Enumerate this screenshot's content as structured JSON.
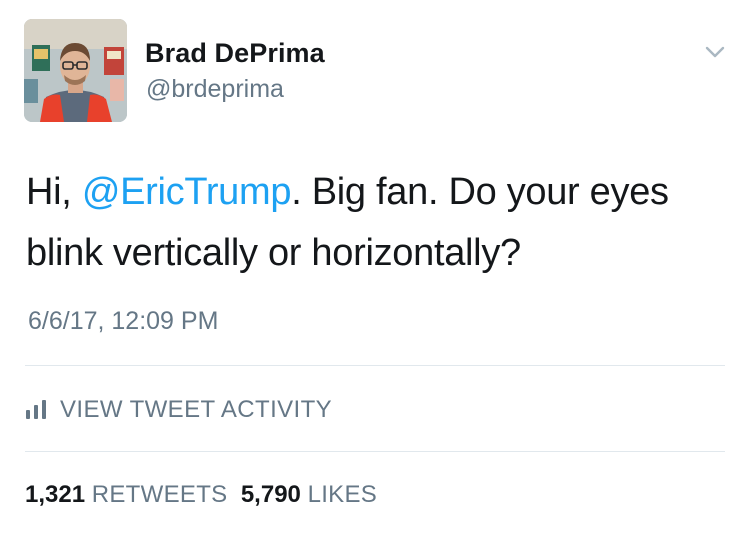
{
  "author": {
    "display_name": "Brad DePrima",
    "handle": "@brdeprima"
  },
  "tweet": {
    "text_before": "Hi, ",
    "mention": "@EricTrump",
    "text_after": ". Big fan. Do your eyes blink vertically or horizontally?",
    "timestamp": "6/6/17, 12:09 PM"
  },
  "activity": {
    "label": "VIEW TWEET ACTIVITY",
    "icon": "bar-chart-icon"
  },
  "stats": {
    "retweets_count": "1,321",
    "retweets_label": "RETWEETS",
    "likes_count": "5,790",
    "likes_label": "LIKES"
  },
  "icons": {
    "menu": "chevron-down-icon",
    "avatar": "avatar"
  },
  "colors": {
    "link": "#1da1f2",
    "secondary_text": "#657786",
    "primary_text": "#14171a",
    "divider": "#e1e8ed",
    "vest": "#e8412c"
  }
}
